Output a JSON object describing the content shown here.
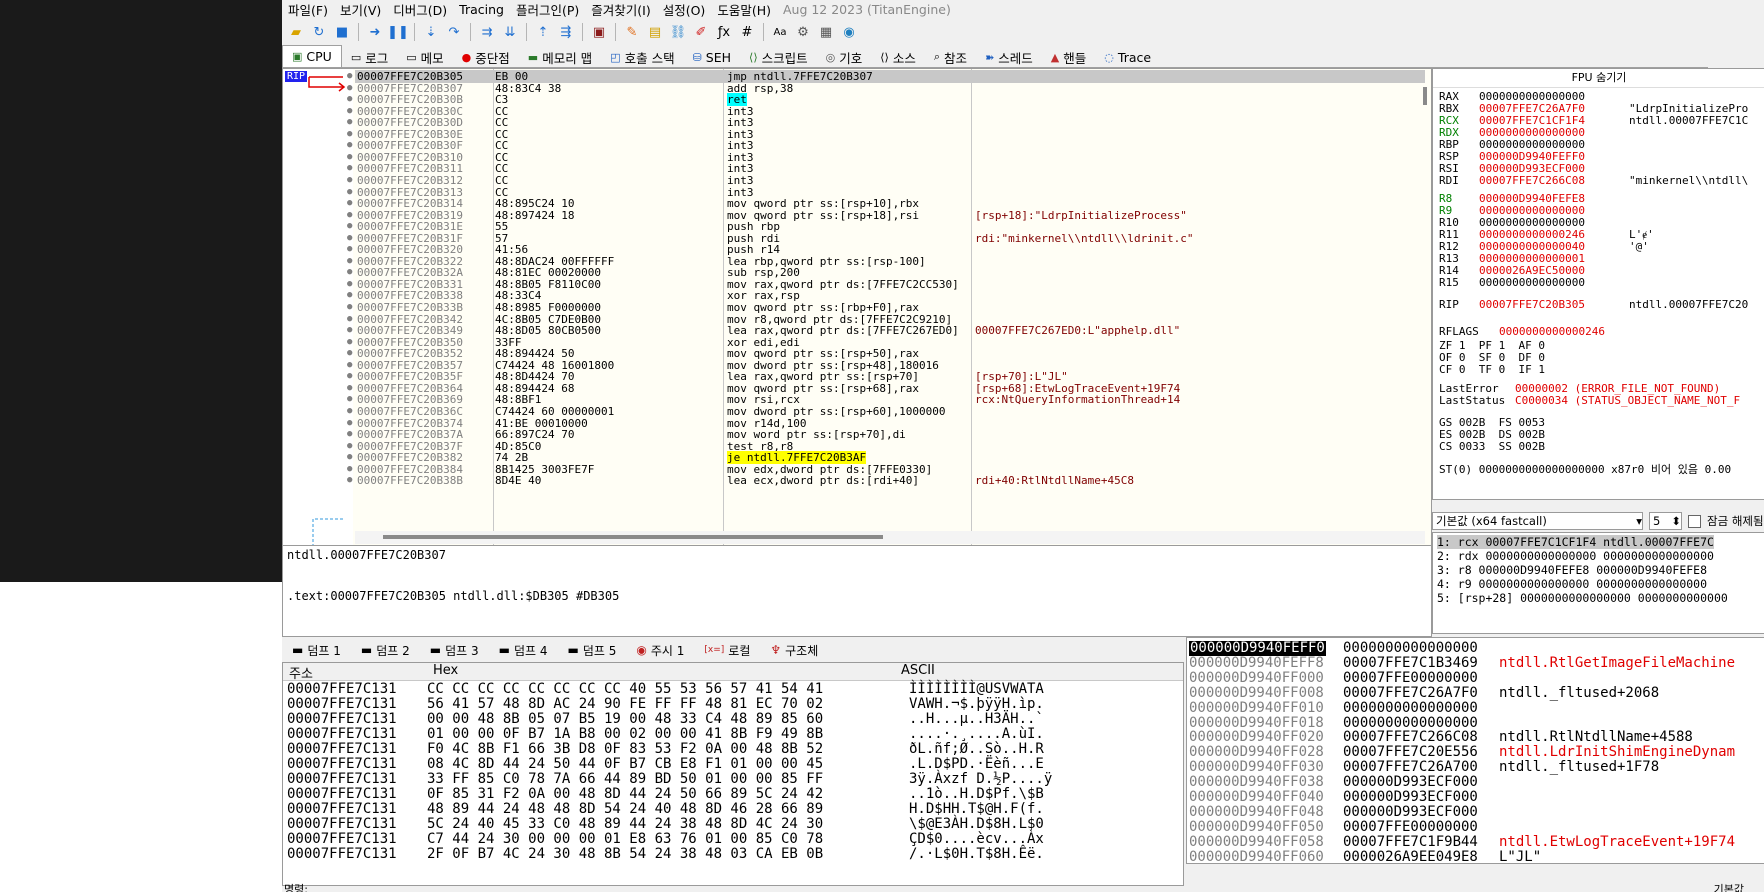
{
  "menu": [
    "파일(F)",
    "보기(V)",
    "디버그(D)",
    "Tracing",
    "플러그인(P)",
    "즐겨찾기(I)",
    "설정(O)",
    "도움말(H)"
  ],
  "build_label": "Aug 12 2023 (TitanEngine)",
  "tabs": [
    {
      "label": "CPU",
      "icon": "cpu-icon"
    },
    {
      "label": "로그",
      "icon": "log-icon"
    },
    {
      "label": "메모",
      "icon": "notes-icon"
    },
    {
      "label": "중단점",
      "icon": "breakpoint-icon"
    },
    {
      "label": "메모리 맵",
      "icon": "memory-map-icon"
    },
    {
      "label": "호출 스택",
      "icon": "call-stack-icon"
    },
    {
      "label": "SEH",
      "icon": "seh-icon"
    },
    {
      "label": "스크립트",
      "icon": "script-icon"
    },
    {
      "label": "기호",
      "icon": "symbols-icon"
    },
    {
      "label": "소스",
      "icon": "source-icon"
    },
    {
      "label": "참조",
      "icon": "references-icon"
    },
    {
      "label": "스레드",
      "icon": "threads-icon"
    },
    {
      "label": "핸들",
      "icon": "handles-icon"
    },
    {
      "label": "Trace",
      "icon": "trace-icon"
    }
  ],
  "rip_label": "RIP",
  "disasm": [
    {
      "addr": "00007FFE7C20B305",
      "bytes": "EB 00",
      "instr": "jmp ntdll.7FFE7C20B307",
      "comment": "",
      "sel": true
    },
    {
      "addr": "00007FFE7C20B307",
      "bytes": "48:83C4 38",
      "instr": "add rsp,38",
      "comment": ""
    },
    {
      "addr": "00007FFE7C20B30B",
      "bytes": "C3",
      "instr": "ret",
      "comment": "",
      "hl": "cyan"
    },
    {
      "addr": "00007FFE7C20B30C",
      "bytes": "CC",
      "instr": "int3",
      "comment": ""
    },
    {
      "addr": "00007FFE7C20B30D",
      "bytes": "CC",
      "instr": "int3",
      "comment": ""
    },
    {
      "addr": "00007FFE7C20B30E",
      "bytes": "CC",
      "instr": "int3",
      "comment": ""
    },
    {
      "addr": "00007FFE7C20B30F",
      "bytes": "CC",
      "instr": "int3",
      "comment": ""
    },
    {
      "addr": "00007FFE7C20B310",
      "bytes": "CC",
      "instr": "int3",
      "comment": ""
    },
    {
      "addr": "00007FFE7C20B311",
      "bytes": "CC",
      "instr": "int3",
      "comment": ""
    },
    {
      "addr": "00007FFE7C20B312",
      "bytes": "CC",
      "instr": "int3",
      "comment": ""
    },
    {
      "addr": "00007FFE7C20B313",
      "bytes": "CC",
      "instr": "int3",
      "comment": ""
    },
    {
      "addr": "00007FFE7C20B314",
      "bytes": "48:895C24 10",
      "instr": "mov qword ptr ss:[rsp+10],rbx",
      "comment": ""
    },
    {
      "addr": "00007FFE7C20B319",
      "bytes": "48:897424 18",
      "instr": "mov qword ptr ss:[rsp+18],rsi",
      "comment": "[rsp+18]:\"LdrpInitializeProcess\""
    },
    {
      "addr": "00007FFE7C20B31E",
      "bytes": "55",
      "instr": "push rbp",
      "comment": ""
    },
    {
      "addr": "00007FFE7C20B31F",
      "bytes": "57",
      "instr": "push rdi",
      "comment": "rdi:\"minkernel\\\\ntdll\\\\ldrinit.c\""
    },
    {
      "addr": "00007FFE7C20B320",
      "bytes": "41:56",
      "instr": "push r14",
      "comment": ""
    },
    {
      "addr": "00007FFE7C20B322",
      "bytes": "48:8DAC24 00FFFFFF",
      "instr": "lea rbp,qword ptr ss:[rsp-100]",
      "comment": ""
    },
    {
      "addr": "00007FFE7C20B32A",
      "bytes": "48:81EC 00020000",
      "instr": "sub rsp,200",
      "comment": ""
    },
    {
      "addr": "00007FFE7C20B331",
      "bytes": "48:8B05 F8110C00",
      "instr": "mov rax,qword ptr ds:[7FFE7C2CC530]",
      "comment": ""
    },
    {
      "addr": "00007FFE7C20B338",
      "bytes": "48:33C4",
      "instr": "xor rax,rsp",
      "comment": ""
    },
    {
      "addr": "00007FFE7C20B33B",
      "bytes": "48:8985 F0000000",
      "instr": "mov qword ptr ss:[rbp+F0],rax",
      "comment": ""
    },
    {
      "addr": "00007FFE7C20B342",
      "bytes": "4C:8B05 C7DE0B00",
      "instr": "mov r8,qword ptr ds:[7FFE7C2C9210]",
      "comment": ""
    },
    {
      "addr": "00007FFE7C20B349",
      "bytes": "48:8D05 80CB0500",
      "instr": "lea rax,qword ptr ds:[7FFE7C267ED0]",
      "comment": "00007FFE7C267ED0:L\"apphelp.dll\""
    },
    {
      "addr": "00007FFE7C20B350",
      "bytes": "33FF",
      "instr": "xor edi,edi",
      "comment": ""
    },
    {
      "addr": "00007FFE7C20B352",
      "bytes": "48:894424 50",
      "instr": "mov qword ptr ss:[rsp+50],rax",
      "comment": ""
    },
    {
      "addr": "00007FFE7C20B357",
      "bytes": "C74424 48 16001800",
      "instr": "mov dword ptr ss:[rsp+48],180016",
      "comment": ""
    },
    {
      "addr": "00007FFE7C20B35F",
      "bytes": "48:8D4424 70",
      "instr": "lea rax,qword ptr ss:[rsp+70]",
      "comment": "[rsp+70]:L\"JL\""
    },
    {
      "addr": "00007FFE7C20B364",
      "bytes": "48:894424 68",
      "instr": "mov qword ptr ss:[rsp+68],rax",
      "comment": "[rsp+68]:EtwLogTraceEvent+19F74"
    },
    {
      "addr": "00007FFE7C20B369",
      "bytes": "48:8BF1",
      "instr": "mov rsi,rcx",
      "comment": "rcx:NtQueryInformationThread+14"
    },
    {
      "addr": "00007FFE7C20B36C",
      "bytes": "C74424 60 00000001",
      "instr": "mov dword ptr ss:[rsp+60],1000000",
      "comment": ""
    },
    {
      "addr": "00007FFE7C20B374",
      "bytes": "41:BE 00010000",
      "instr": "mov r14d,100",
      "comment": ""
    },
    {
      "addr": "00007FFE7C20B37A",
      "bytes": "66:897C24 70",
      "instr": "mov word ptr ss:[rsp+70],di",
      "comment": ""
    },
    {
      "addr": "00007FFE7C20B37F",
      "bytes": "4D:85C0",
      "instr": "test r8,r8",
      "comment": ""
    },
    {
      "addr": "00007FFE7C20B382",
      "bytes": "74 2B",
      "instr": "je ntdll.7FFE7C20B3AF",
      "comment": "",
      "hl": "yellow"
    },
    {
      "addr": "00007FFE7C20B384",
      "bytes": "8B1425 3003FE7F",
      "instr": "mov edx,dword ptr ds:[7FFE0330]",
      "comment": ""
    },
    {
      "addr": "00007FFE7C20B38B",
      "bytes": "8D4E 40",
      "instr": "lea ecx,dword ptr ds:[rdi+40]",
      "comment": "rdi+40:RtlNtdllName+45C8"
    }
  ],
  "info": {
    "line1": "ntdll.00007FFE7C20B307",
    "line2": ".text:00007FFE7C20B305 ntdll.dll:$DB305 #DB305"
  },
  "regs_header": "FPU 숨기기",
  "regs": [
    {
      "n": "RAX",
      "v": "0000000000000000",
      "c": ""
    },
    {
      "n": "RBX",
      "v": "00007FFE7C26A7F0",
      "c": "\"LdrpInitializePro",
      "red": true
    },
    {
      "n": "RCX",
      "v": "00007FFE7C1CF1F4",
      "c": "ntdll.00007FFE7C1C",
      "red": true,
      "green": true
    },
    {
      "n": "RDX",
      "v": "0000000000000000",
      "c": "",
      "red": true,
      "green": true
    },
    {
      "n": "RBP",
      "v": "0000000000000000",
      "c": ""
    },
    {
      "n": "RSP",
      "v": "000000D9940FEFF0",
      "c": "",
      "red": true
    },
    {
      "n": "RSI",
      "v": "000000D993ECF000",
      "c": "",
      "red": true
    },
    {
      "n": "RDI",
      "v": "00007FFE7C266C08",
      "c": "\"minkernel\\\\ntdll\\",
      "red": true
    },
    {
      "n": "R8",
      "v": "000000D9940FEFE8",
      "c": "",
      "red": true,
      "green": true
    },
    {
      "n": "R9",
      "v": "0000000000000000",
      "c": "",
      "red": true,
      "green": true
    },
    {
      "n": "R10",
      "v": "0000000000000000",
      "c": ""
    },
    {
      "n": "R11",
      "v": "0000000000000246",
      "c": "L'ɇ'",
      "red": true
    },
    {
      "n": "R12",
      "v": "0000000000000040",
      "c": "'@'",
      "red": true
    },
    {
      "n": "R13",
      "v": "0000000000000001",
      "c": "",
      "red": true
    },
    {
      "n": "R14",
      "v": "0000026A9EC50000",
      "c": "",
      "red": true
    },
    {
      "n": "R15",
      "v": "0000000000000000",
      "c": ""
    },
    {
      "n": "RIP",
      "v": "00007FFE7C20B305",
      "c": "ntdll.00007FFE7C20",
      "red": true
    }
  ],
  "rflags": {
    "label": "RFLAGS",
    "value": "0000000000000246"
  },
  "flags": [
    "ZF 1  PF 1  AF 0",
    "OF 0  SF 0  DF 0",
    "CF 0  TF 0  IF 1"
  ],
  "last_error": {
    "label": "LastError",
    "value": "00000002 (ERROR_FILE_NOT_FOUND)"
  },
  "last_status": {
    "label": "LastStatus",
    "value": "C0000034 (STATUS_OBJECT_NAME_NOT_F"
  },
  "segs": [
    "GS 002B  FS 0053",
    "ES 002B  DS 002B",
    "CS 0033  SS 002B"
  ],
  "st0": "ST(0) 0000000000000000000 x87r0 비어 있음 0.00",
  "callconv": {
    "label": "기본값 (x64 fastcall)",
    "count": "5",
    "unlock_label": "잠금 해제됨"
  },
  "args": [
    "1: rcx 00007FFE7C1CF1F4 ntdll.00007FFE7C",
    "2: rdx 0000000000000000 0000000000000000",
    "3: r8 000000D9940FEFE8 000000D9940FEFE8",
    "4: r9 0000000000000000 0000000000000000",
    "5: [rsp+28] 0000000000000000 0000000000000"
  ],
  "dump_tabs": [
    {
      "label": "덤프 1",
      "icon": "dump-icon"
    },
    {
      "label": "덤프 2",
      "icon": "dump-icon"
    },
    {
      "label": "덤프 3",
      "icon": "dump-icon"
    },
    {
      "label": "덤프 4",
      "icon": "dump-icon"
    },
    {
      "label": "덤프 5",
      "icon": "dump-icon"
    },
    {
      "label": "주시 1",
      "icon": "watch-icon"
    },
    {
      "label": "로컬",
      "icon": "locals-icon"
    },
    {
      "label": "구조체",
      "icon": "struct-icon"
    }
  ],
  "dump_head": {
    "addr": "주소",
    "hex": "Hex",
    "ascii": "ASCII"
  },
  "dump": [
    {
      "a": "00007FFE7C131",
      "h": "CC CC CC CC CC CC CC CC 40 55 53 56 57 41 54 41",
      "s": "ÌÌÌÌÌÌÌÌ@USVWATA"
    },
    {
      "a": "00007FFE7C131",
      "h": "56 41 57 48 8D AC 24 90 FE FF FF 48 81 EC 70 02",
      "s": "VAWH.¬$.þÿÿH.ìp."
    },
    {
      "a": "00007FFE7C131",
      "h": "00 00 48 8B 05 07 B5 19 00 48 33 C4 48 89 85 60",
      "s": "..H...µ..H3ÄH..`"
    },
    {
      "a": "00007FFE7C131",
      "h": "01 00 00 0F B7 1A B8 00 02 00 00 41 8B F9 49 8B",
      "s": "....·.¸....A.ùI."
    },
    {
      "a": "00007FFE7C131",
      "h": "F0 4C 8B F1 66 3B D8 0F 83 53 F2 0A 00 48 8B 52",
      "s": "ðL.ñf;Ø..Sò..H.R"
    },
    {
      "a": "00007FFE7C131",
      "h": "08 4C 8D 44 24 50 44 0F B7 CB E8 F1 01 00 00 45",
      "s": ".L.D$PD.·Ëèñ...E"
    },
    {
      "a": "00007FFE7C131",
      "h": "33 FF 85 C0 78 7A 66 44 89 BD 50 01 00 00 85 FF",
      "s": "3ÿ.Àxzf D.½P....ÿ"
    },
    {
      "a": "00007FFE7C131",
      "h": "0F 85 31 F2 0A 00 48 8D 44 24 50 66 89 5C 24 42",
      "s": "..1ò..H.D$Pf.\\$B"
    },
    {
      "a": "00007FFE7C131",
      "h": "48 89 44 24 48 48 8D 54 24 40 48 8D 46 28 66 89",
      "s": "H.D$HH.T$@H.F(f."
    },
    {
      "a": "00007FFE7C131",
      "h": "5C 24 40 45 33 C0 48 89 44 24 38 48 8D 4C 24 30",
      "s": "\\$@E3ÀH.D$8H.L$0"
    },
    {
      "a": "00007FFE7C131",
      "h": "C7 44 24 30 00 00 00 01 E8 63 76 01 00 85 C0 78",
      "s": "ÇD$0....ècv...Àx"
    },
    {
      "a": "00007FFE7C131",
      "h": "2F 0F B7 4C 24 30 48 8B 54 24 38 48 03 CA EB 0B",
      "s": "/.·L$0H.T$8H.Êë."
    }
  ],
  "stack": [
    {
      "a": "000000D9940FEFF0",
      "v": "0000000000000000",
      "c": "",
      "top": true
    },
    {
      "a": "000000D9940FEFF8",
      "v": "00007FFE7C1B3469",
      "c": "ntdll.RtlGetImageFileMachine",
      "red": true
    },
    {
      "a": "000000D9940FF000",
      "v": "00007FFE00000000",
      "c": ""
    },
    {
      "a": "000000D9940FF008",
      "v": "00007FFE7C26A7F0",
      "c": "ntdll._fltused+2068"
    },
    {
      "a": "000000D9940FF010",
      "v": "0000000000000000",
      "c": ""
    },
    {
      "a": "000000D9940FF018",
      "v": "0000000000000000",
      "c": ""
    },
    {
      "a": "000000D9940FF020",
      "v": "00007FFE7C266C08",
      "c": "ntdll.RtlNtdllName+4588"
    },
    {
      "a": "000000D9940FF028",
      "v": "00007FFE7C20E556",
      "c": "ntdll.LdrInitShimEngineDynam",
      "red": true
    },
    {
      "a": "000000D9940FF030",
      "v": "00007FFE7C26A700",
      "c": "ntdll._fltused+1F78"
    },
    {
      "a": "000000D9940FF038",
      "v": "000000D993ECF000",
      "c": ""
    },
    {
      "a": "000000D9940FF040",
      "v": "000000D993ECF000",
      "c": ""
    },
    {
      "a": "000000D9940FF048",
      "v": "000000D993ECF000",
      "c": ""
    },
    {
      "a": "000000D9940FF050",
      "v": "00007FFE00000000",
      "c": ""
    },
    {
      "a": "000000D9940FF058",
      "v": "00007FFE7C1F9B44",
      "c": "ntdll.EtwLogTraceEvent+19F74",
      "red": true
    },
    {
      "a": "000000D9940FF060",
      "v": "0000026A9EE049E8",
      "c": "L\"JL\""
    }
  ],
  "cmd_label": "명령:",
  "cmd_default": "기본값"
}
